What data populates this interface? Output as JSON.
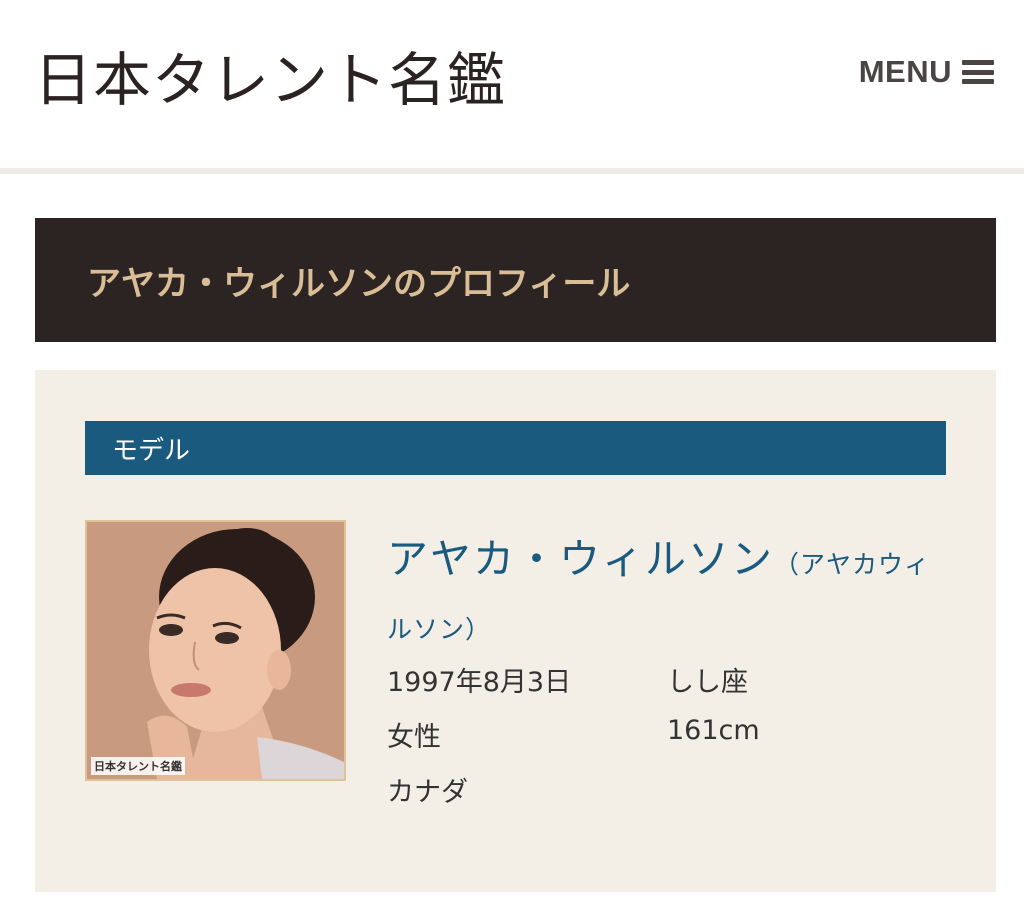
{
  "header": {
    "site_title": "日本タレント名鑑",
    "menu_label": "MENU",
    "menu_icon": "hamburger-icon"
  },
  "profile_banner": {
    "title": "アヤカ・ウィルソンのプロフィール"
  },
  "card": {
    "category": "モデル",
    "photo": {
      "watermark": "日本タレント名鑑"
    },
    "name": "アヤカ・ウィルソン",
    "name_kana": "（アヤカウィルソン）",
    "birthday": "1997年8月3日",
    "zodiac": "しし座",
    "gender": "女性",
    "height": "161cm",
    "birthplace": "カナダ"
  },
  "colors": {
    "banner_bg": "#2c2323",
    "banner_text": "#d9bd97",
    "accent_blue": "#1a5a7e",
    "card_bg": "#f3efe7"
  }
}
